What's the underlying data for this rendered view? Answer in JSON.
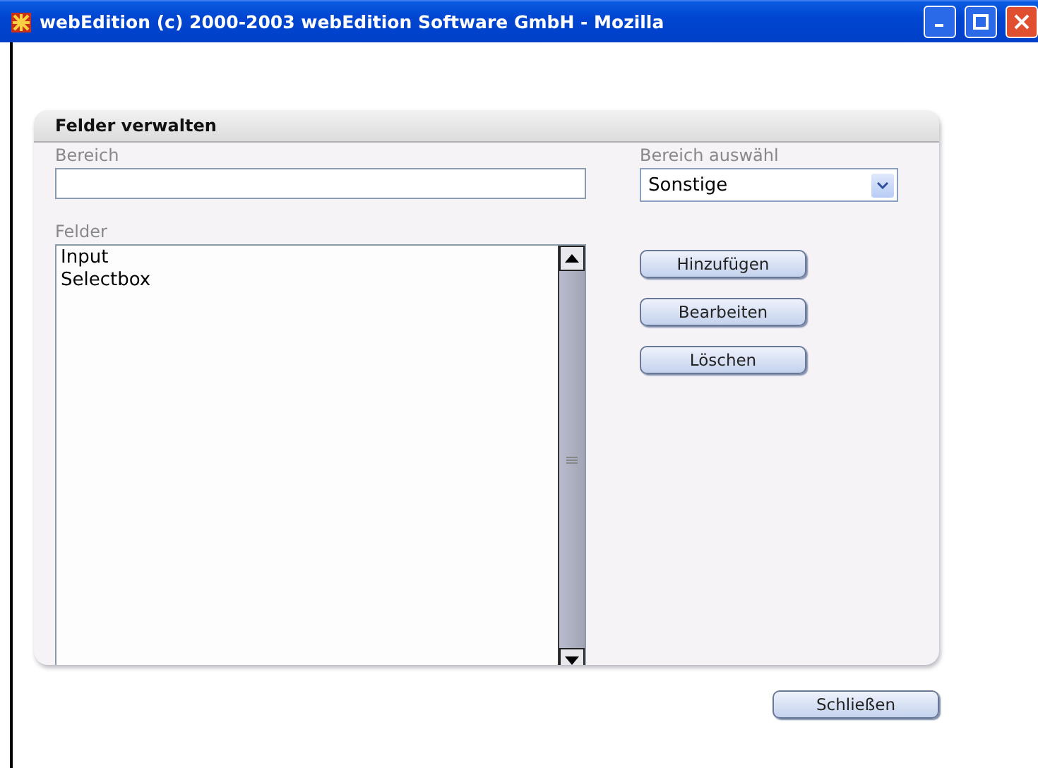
{
  "window": {
    "title": "webEdition (c) 2000-2003 webEdition Software GmbH - Mozilla"
  },
  "panel": {
    "title": "Felder verwalten",
    "bereich": {
      "label": "Bereich"
    },
    "bereich_select": {
      "label": "Bereich auswähl",
      "value": "Sonstige"
    },
    "felder": {
      "label": "Felder",
      "items": [
        {
          "label": "Input",
          "selected": false
        },
        {
          "label": "Selectbox",
          "selected": false
        }
      ]
    },
    "buttons": [
      "Hinzufügen",
      "Bearbeiten",
      "Löschen"
    ]
  },
  "footer_button": "Schließen"
}
